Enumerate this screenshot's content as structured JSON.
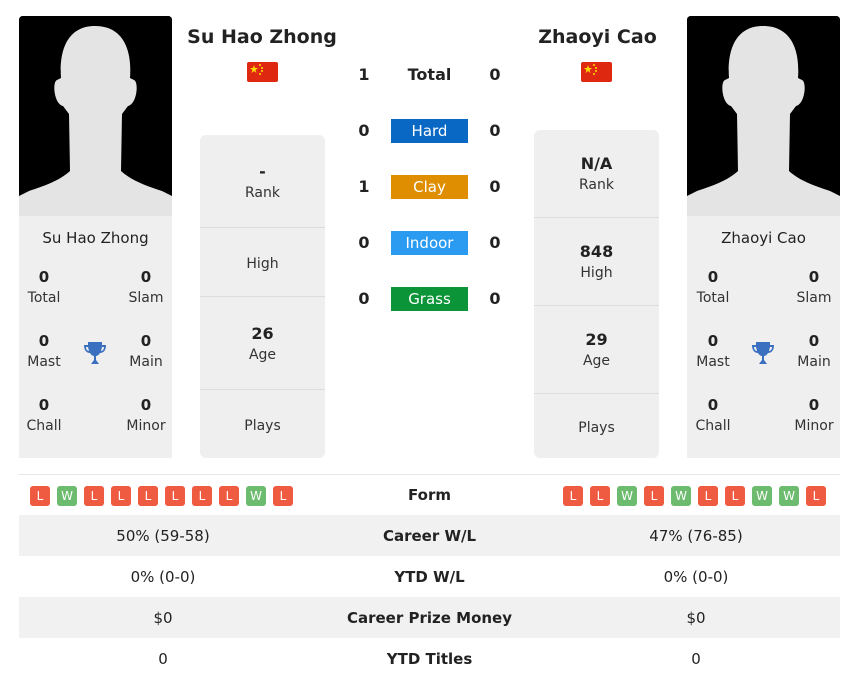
{
  "player1": {
    "name": "Su Hao Zhong",
    "card_name": "Su Hao Zhong",
    "flag": "china-flag",
    "titles": {
      "total": "0",
      "slam": "0",
      "mast": "0",
      "main": "0",
      "chall": "0",
      "minor": "0"
    },
    "rank": "-",
    "high": "",
    "age": "26",
    "plays": "",
    "form": [
      "L",
      "W",
      "L",
      "L",
      "L",
      "L",
      "L",
      "L",
      "W",
      "L"
    ]
  },
  "player2": {
    "name": "Zhaoyi Cao",
    "card_name": "Zhaoyi Cao",
    "flag": "china-flag",
    "titles": {
      "total": "0",
      "slam": "0",
      "mast": "0",
      "main": "0",
      "chall": "0",
      "minor": "0"
    },
    "rank": "N/A",
    "high": "848",
    "age": "29",
    "plays": "",
    "form": [
      "L",
      "L",
      "W",
      "L",
      "W",
      "L",
      "L",
      "W",
      "W",
      "L"
    ]
  },
  "labels": {
    "total": "Total",
    "slam": "Slam",
    "mast": "Mast",
    "main": "Main",
    "chall": "Chall",
    "minor": "Minor",
    "rank": "Rank",
    "high": "High",
    "age": "Age",
    "plays": "Plays",
    "form": "Form"
  },
  "h2h": [
    {
      "label": "Total",
      "p1": "1",
      "p2": "0",
      "color": ""
    },
    {
      "label": "Hard",
      "p1": "0",
      "p2": "0",
      "color": "#0868c4"
    },
    {
      "label": "Clay",
      "p1": "1",
      "p2": "0",
      "color": "#de8e00"
    },
    {
      "label": "Indoor",
      "p1": "0",
      "p2": "0",
      "color": "#2b9bf2"
    },
    {
      "label": "Grass",
      "p1": "0",
      "p2": "0",
      "color": "#0b9438"
    }
  ],
  "table": [
    {
      "label": "Career W/L",
      "p1": "50% (59-58)",
      "p2": "47% (76-85)"
    },
    {
      "label": "YTD W/L",
      "p1": "0% (0-0)",
      "p2": "0% (0-0)"
    },
    {
      "label": "Career Prize Money",
      "p1": "$0",
      "p2": "$0"
    },
    {
      "label": "YTD Titles",
      "p1": "0",
      "p2": "0"
    }
  ],
  "colors": {
    "win": "#6cbb6e",
    "loss": "#ef5b40"
  }
}
